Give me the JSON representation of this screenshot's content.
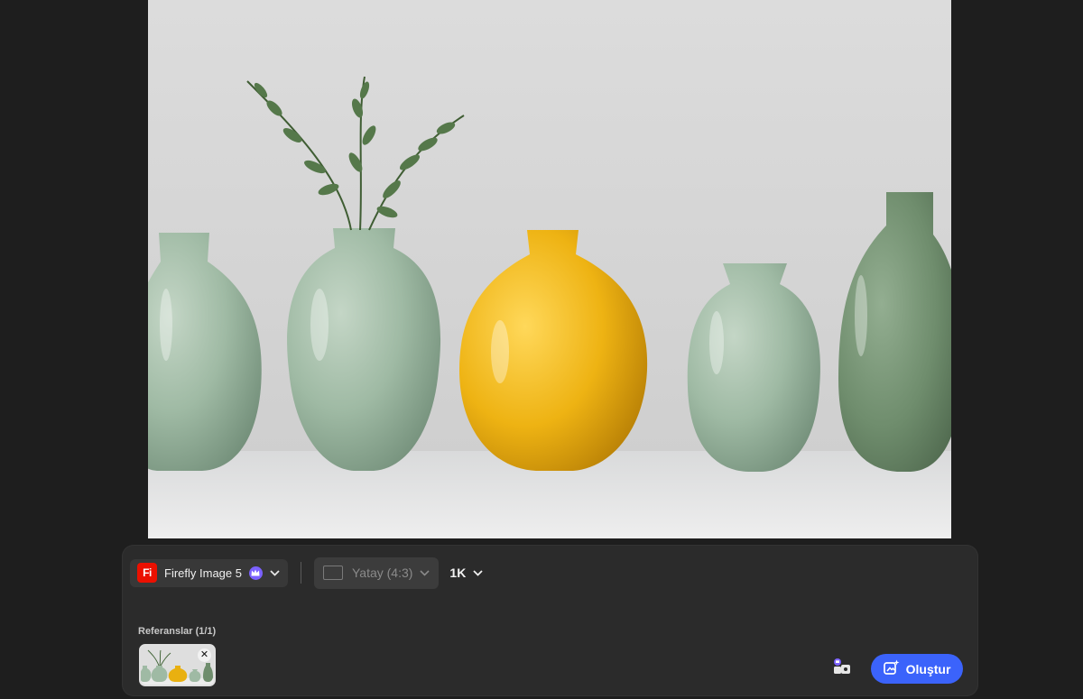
{
  "toolbar": {
    "model_logo_text": "Fi",
    "model_label": "Firefly Image 5",
    "model_badge_icon": "crown-icon",
    "aspect_label": "Yatay (4:3)",
    "resolution_label": "1K"
  },
  "references": {
    "label": "Referanslar (1/1)",
    "remove_symbol": "✕"
  },
  "actions": {
    "generate_label": "Oluştur"
  },
  "colors": {
    "accent": "#3b63fb",
    "logo_red": "#eb1000",
    "premium_purple": "#7b61ff",
    "panel": "#2b2b2b",
    "background": "#1e1e1e"
  }
}
